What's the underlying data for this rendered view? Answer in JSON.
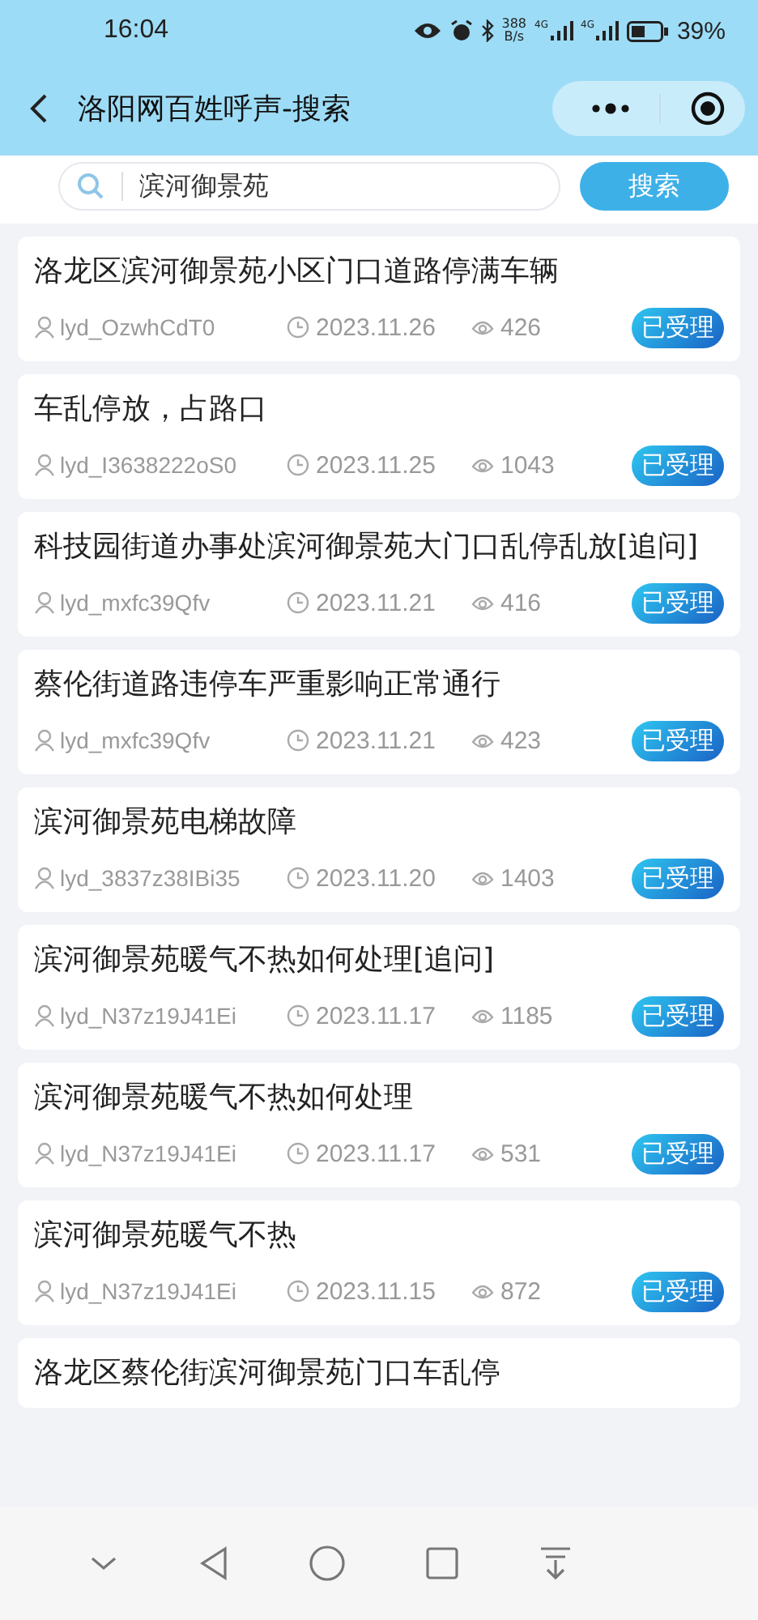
{
  "status_bar": {
    "time": "16:04",
    "net_speed": "388",
    "net_unit": "B/s",
    "signal_labels": [
      "4G",
      "4G"
    ],
    "battery": "39%"
  },
  "header": {
    "title": "洛阳网百姓呼声-搜索"
  },
  "search": {
    "value": "滨河御景苑",
    "button": "搜索"
  },
  "posts": [
    {
      "title": "洛龙区滨河御景苑小区门口道路停满车辆",
      "user": "lyd_OzwhCdT0",
      "date": "2023.11.26",
      "views": "426",
      "status": "已受理"
    },
    {
      "title": "车乱停放，占路口",
      "user": "lyd_I3638222oS0",
      "date": "2023.11.25",
      "views": "1043",
      "status": "已受理"
    },
    {
      "title": "科技园街道办事处滨河御景苑大门口乱停乱放[追问]",
      "user": "lyd_mxfc39Qfv",
      "date": "2023.11.21",
      "views": "416",
      "status": "已受理"
    },
    {
      "title": "蔡伦街道路违停车严重影响正常通行",
      "user": "lyd_mxfc39Qfv",
      "date": "2023.11.21",
      "views": "423",
      "status": "已受理"
    },
    {
      "title": "滨河御景苑电梯故障",
      "user": "lyd_3837z38IBi35",
      "date": "2023.11.20",
      "views": "1403",
      "status": "已受理"
    },
    {
      "title": "滨河御景苑暖气不热如何处理[追问]",
      "user": "lyd_N37z19J41Ei",
      "date": "2023.11.17",
      "views": "1185",
      "status": "已受理"
    },
    {
      "title": "滨河御景苑暖气不热如何处理",
      "user": "lyd_N37z19J41Ei",
      "date": "2023.11.17",
      "views": "531",
      "status": "已受理"
    },
    {
      "title": "滨河御景苑暖气不热",
      "user": "lyd_N37z19J41Ei",
      "date": "2023.11.15",
      "views": "872",
      "status": "已受理"
    },
    {
      "title": "洛龙区蔡伦街滨河御景苑门口车乱停"
    }
  ]
}
